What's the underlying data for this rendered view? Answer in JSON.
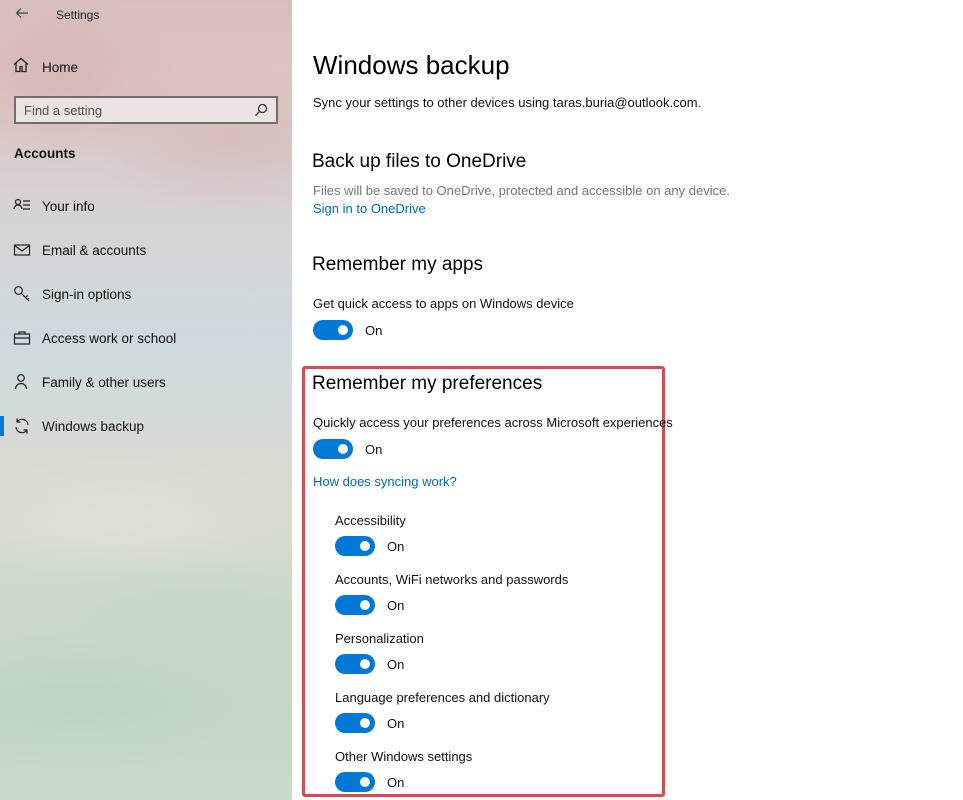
{
  "window": {
    "app_title": "Settings"
  },
  "sidebar": {
    "home_label": "Home",
    "search_placeholder": "Find a setting",
    "section_title": "Accounts",
    "items": [
      {
        "label": "Your info",
        "icon": "contact-info-icon"
      },
      {
        "label": "Email & accounts",
        "icon": "mail-icon"
      },
      {
        "label": "Sign-in options",
        "icon": "key-icon"
      },
      {
        "label": "Access work or school",
        "icon": "briefcase-icon"
      },
      {
        "label": "Family & other users",
        "icon": "person-icon"
      },
      {
        "label": "Windows backup",
        "icon": "sync-icon",
        "active": true
      }
    ]
  },
  "main": {
    "title": "Windows backup",
    "subtitle": "Sync your settings to other devices using taras.buria@outlook.com.",
    "onedrive": {
      "heading": "Back up files to OneDrive",
      "description": "Files will be saved to OneDrive, protected and accessible on any device.",
      "link": "Sign in to OneDrive"
    },
    "apps": {
      "heading": "Remember my apps",
      "description": "Get quick access to apps on Windows device",
      "toggle_state": "On"
    },
    "preferences": {
      "heading": "Remember my preferences",
      "description": "Quickly access your preferences across Microsoft experiences",
      "toggle_state": "On",
      "link": "How does syncing work?",
      "items": [
        {
          "label": "Accessibility",
          "state": "On"
        },
        {
          "label": "Accounts, WiFi networks and passwords",
          "state": "On"
        },
        {
          "label": "Personalization",
          "state": "On"
        },
        {
          "label": "Language preferences and dictionary",
          "state": "On"
        },
        {
          "label": "Other Windows settings",
          "state": "On"
        }
      ]
    }
  },
  "colors": {
    "accent": "#0078d7",
    "link": "#0067c0",
    "highlight": "#d64a52"
  }
}
